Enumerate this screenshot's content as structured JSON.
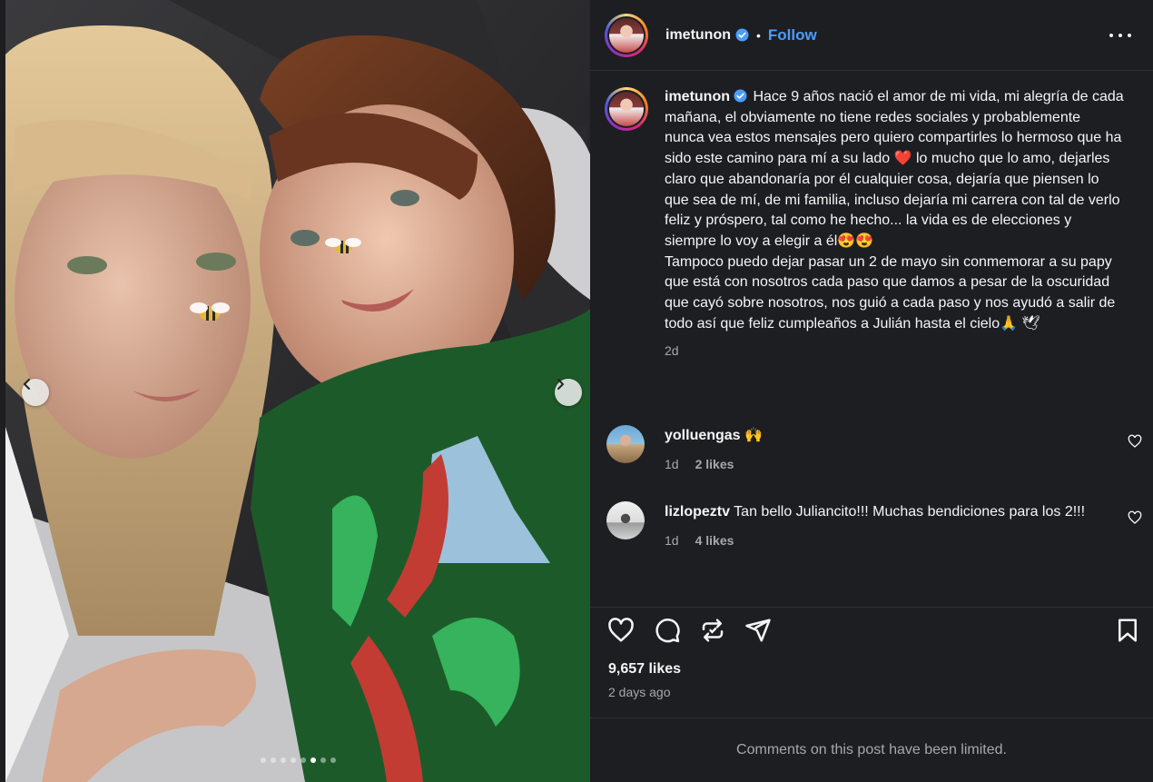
{
  "post": {
    "image_count": 8,
    "active_image_index": 5
  },
  "header": {
    "username": "imetunon",
    "separator": "•",
    "follow_label": "Follow"
  },
  "caption": {
    "username": "imetunon",
    "text_part1": "Hace 9 años nació el amor de mi vida, mi alegría de cada mañana, el obviamente no tiene redes sociales y probablemente nunca vea estos mensajes pero quiero compartirles lo hermoso que ha sido este camino para mí a su lado ",
    "emoji_heart": "❤️",
    "text_part2": " lo mucho que lo amo, dejarles claro que abandonaría por él cualquier cosa, dejaría que piensen lo que sea de mí, de mi familia, incluso dejaría mi carrera con tal de verlo feliz y próspero, tal como he hecho... la vida es de elecciones y siempre lo voy a elegir a él",
    "emoji_eyes": "😍😍",
    "text_part3": "\nTampoco puedo dejar pasar un 2 de mayo sin conmemorar a su papy que está con nosotros cada paso que damos a pesar de la oscuridad que cayó sobre nosotros, nos guió a cada paso y nos ayudó a salir de todo así que feliz cumpleaños a Julián hasta el cielo",
    "emoji_end": "🙏 🕊",
    "time": "2d"
  },
  "comments": [
    {
      "username": "yolluengas",
      "text": "🙌",
      "time": "1d",
      "likes": "2 likes"
    },
    {
      "username": "lizlopeztv",
      "text": "Tan bello Juliancito!!! Muchas bendiciones para los 2!!!",
      "time": "1d",
      "likes": "4 likes"
    }
  ],
  "stats": {
    "likes": "9,657 likes",
    "date": "2 days ago"
  },
  "footer": {
    "limited_text": "Comments on this post have been limited."
  },
  "colors": {
    "panel_bg": "#1d1e22",
    "accent_blue": "#4a9dfd",
    "muted_text": "#a8a8a8",
    "heart_red": "#e0245e"
  },
  "icons": {
    "prev": "chevron-left-icon",
    "next": "chevron-right-icon",
    "verified": "verified-badge-icon",
    "more": "more-options-icon",
    "like": "heart-icon",
    "comment": "comment-icon",
    "repost": "repost-icon",
    "share": "send-icon",
    "save": "bookmark-icon"
  }
}
